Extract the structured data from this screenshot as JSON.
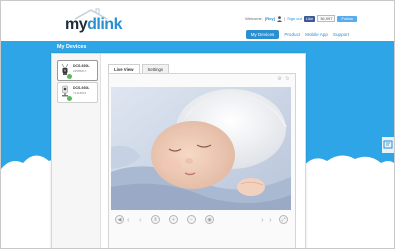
{
  "header": {
    "logo_my": "my",
    "logo_dlink": "dlink",
    "welcome_text": "Welcome,",
    "username": "[Roy]",
    "sign_out": "Sign out",
    "fb_label": "Like",
    "fb_count": "36,997",
    "tw_label": "Follow"
  },
  "nav": {
    "items": [
      {
        "label": "My Devices"
      },
      {
        "label": "Product"
      },
      {
        "label": "Mobile App"
      },
      {
        "label": "Support"
      }
    ]
  },
  "band": {
    "title": "My Devices"
  },
  "devices": [
    {
      "name": "DCS-930L",
      "id": "29585817"
    },
    {
      "name": "DCS-930L",
      "id": "71318061"
    }
  ],
  "tabs": [
    {
      "label": "Live View"
    },
    {
      "label": "Settings"
    }
  ],
  "controls": {
    "icons": [
      "speaker-icon",
      "left-arrow-icon",
      "pause-icon",
      "zoom-in-icon",
      "zoom-out-icon",
      "snapshot-icon",
      "right-arrow-icon",
      "fullscreen-icon"
    ]
  },
  "colors": {
    "brand_blue": "#2da5e6",
    "accent": "#2a8fd0",
    "online": "#5cb85c"
  }
}
